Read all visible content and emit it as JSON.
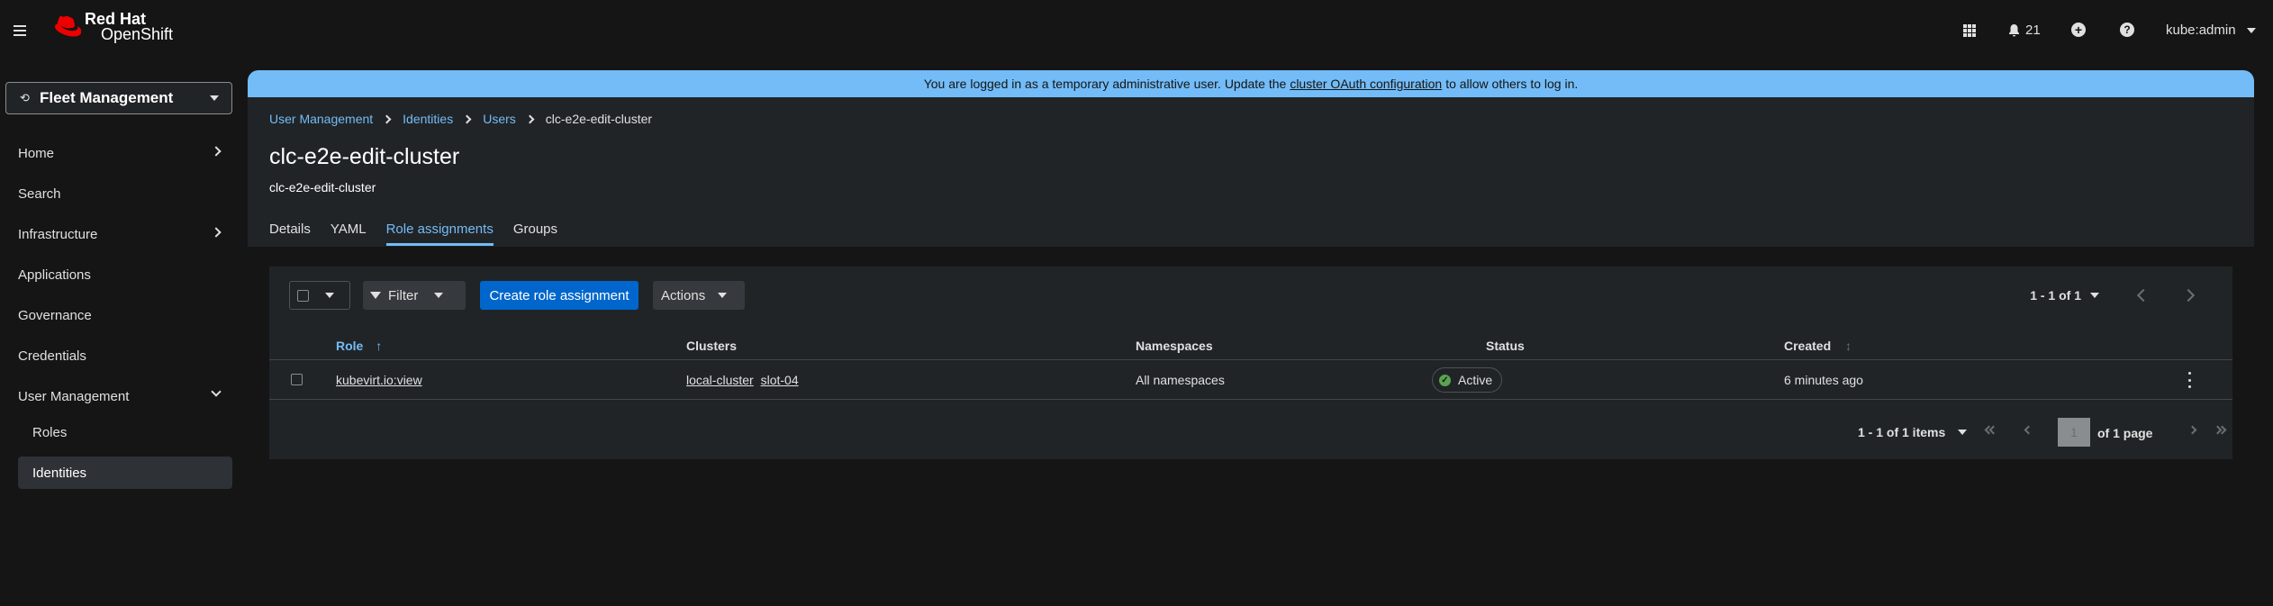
{
  "masthead": {
    "brand_line1": "Red Hat",
    "brand_line2": "OpenShift",
    "notification_count": "21",
    "user": "kube:admin",
    "icons": [
      "hamburger-icon",
      "app-launcher-icon",
      "bell-icon",
      "plus-circle-icon",
      "help-icon",
      "caret-down-icon"
    ]
  },
  "sidebar": {
    "perspective": "Fleet Management",
    "items": [
      {
        "label": "Home",
        "expandable": true
      },
      {
        "label": "Search",
        "expandable": false
      },
      {
        "label": "Infrastructure",
        "expandable": true
      },
      {
        "label": "Applications",
        "expandable": false
      },
      {
        "label": "Governance",
        "expandable": false
      },
      {
        "label": "Credentials",
        "expandable": false
      },
      {
        "label": "User Management",
        "expandable": true,
        "expanded": true
      }
    ],
    "subitems": [
      {
        "label": "Roles",
        "active": false
      },
      {
        "label": "Identities",
        "active": true
      }
    ]
  },
  "banner": {
    "text_before": "You are logged in as a temporary administrative user. Update the",
    "link": "cluster OAuth configuration",
    "text_after": "to allow others to log in.",
    "color": "#73bcf7"
  },
  "breadcrumb": {
    "items": [
      "User Management",
      "Identities",
      "Users"
    ],
    "current": "clc-e2e-edit-cluster"
  },
  "page": {
    "title": "clc-e2e-edit-cluster",
    "subtitle": "clc-e2e-edit-cluster"
  },
  "tabs": [
    {
      "label": "Details",
      "active": false
    },
    {
      "label": "YAML",
      "active": false
    },
    {
      "label": "Role assignments",
      "active": true
    },
    {
      "label": "Groups",
      "active": false
    }
  ],
  "toolbar": {
    "filter_label": "Filter",
    "create_label": "Create role assignment",
    "actions_label": "Actions",
    "pagination_top": "1 - 1 of 1"
  },
  "table": {
    "columns": [
      "Role",
      "Clusters",
      "Namespaces",
      "Status",
      "Created"
    ],
    "rows": [
      {
        "role": "kubevirt.io:view",
        "clusters": [
          "local-cluster",
          "slot-04"
        ],
        "namespaces": "All namespaces",
        "status": "Active",
        "created": "6 minutes ago"
      }
    ]
  },
  "pagination_bottom": {
    "count": "1 - 1 of 1 items",
    "page": "1",
    "of_pages": "of 1 page"
  },
  "colors": {
    "accent": "#0066cc",
    "link": "#73bcf7",
    "success": "#5ba352",
    "background": "#151515",
    "surface": "#212427"
  }
}
